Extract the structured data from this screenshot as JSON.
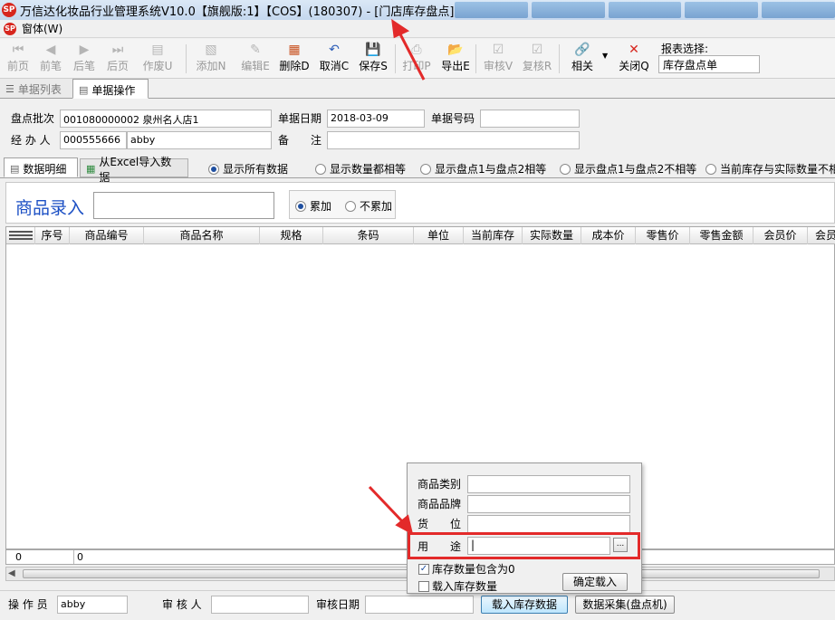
{
  "window": {
    "title": "万信达化妆品行业管理系统V10.0【旗舰版:1】【COS】(180307) - [门店库存盘点]",
    "logo_text": "SP"
  },
  "menu": {
    "items": [
      "窗体(W)"
    ]
  },
  "toolbar": {
    "buttons": [
      {
        "label": "前页",
        "icon": "first-page-icon",
        "enabled": false
      },
      {
        "label": "前笔",
        "icon": "prev-icon",
        "enabled": false
      },
      {
        "label": "后笔",
        "icon": "next-icon",
        "enabled": false
      },
      {
        "label": "后页",
        "icon": "last-page-icon",
        "enabled": false
      },
      {
        "label": "作废U",
        "icon": "void-icon",
        "enabled": false
      },
      {
        "label": "添加N",
        "icon": "add-icon",
        "enabled": false
      },
      {
        "label": "编辑E",
        "icon": "edit-icon",
        "enabled": false
      },
      {
        "label": "删除D",
        "icon": "delete-icon",
        "enabled": true
      },
      {
        "label": "取消C",
        "icon": "undo-icon",
        "enabled": true
      },
      {
        "label": "保存S",
        "icon": "save-icon",
        "enabled": true
      },
      {
        "label": "打印P",
        "icon": "print-icon",
        "enabled": false
      },
      {
        "label": "导出E",
        "icon": "export-icon",
        "enabled": true
      },
      {
        "label": "审核V",
        "icon": "approve-icon",
        "enabled": false
      },
      {
        "label": "复核R",
        "icon": "recheck-icon",
        "enabled": false
      },
      {
        "label": "相关",
        "icon": "link-icon",
        "enabled": true
      },
      {
        "label": "关闭Q",
        "icon": "close-icon",
        "enabled": true
      }
    ],
    "report_label": "报表选择:",
    "report_value": "库存盘点单"
  },
  "tabs": [
    {
      "label": "单据列表",
      "active": false
    },
    {
      "label": "单据操作",
      "active": true
    }
  ],
  "form": {
    "batch_label": "盘点批次",
    "batch_value": "001080000002 泉州名人店1",
    "date_label": "单据日期",
    "date_value": "2018-03-09",
    "docno_label": "单据号码",
    "docno_value": "",
    "handler_label": "经 办 人",
    "handler_code": "000555666",
    "handler_name": "abby",
    "remark_label": "备　　注",
    "remark_value": ""
  },
  "subtabs": [
    {
      "label": "数据明细",
      "active": true
    },
    {
      "label": "从Excel导入数据",
      "active": false
    }
  ],
  "filters": [
    {
      "label": "显示所有数据",
      "selected": true
    },
    {
      "label": "显示数量都相等",
      "selected": false
    },
    {
      "label": "显示盘点1与盘点2相等",
      "selected": false
    },
    {
      "label": "显示盘点1与盘点2不相等",
      "selected": false
    },
    {
      "label": "当前库存与实际数量不相",
      "selected": false
    }
  ],
  "entry": {
    "title": "商品录入",
    "value": "",
    "accumulate": {
      "label": "累加",
      "selected": true
    },
    "no_accumulate": {
      "label": "不累加",
      "selected": false
    }
  },
  "grid": {
    "columns": [
      "序号",
      "商品编号",
      "商品名称",
      "规格",
      "条码",
      "单位",
      "当前库存",
      "实际数量",
      "成本价",
      "零售价",
      "零售金额",
      "会员价",
      "会员"
    ],
    "rows": [],
    "footer_count": "0",
    "footer_value": "0"
  },
  "popup": {
    "category_label": "商品类别",
    "brand_label": "商品品牌",
    "location_label": "货　　位",
    "usage_label": "用　　途",
    "usage_value": "|",
    "usage_button": "...",
    "include_zero_label": "库存数量包含为0",
    "include_zero_checked": true,
    "load_stock_label": "载入库存数量",
    "load_stock_checked": false,
    "confirm_label": "确定载入"
  },
  "bottom": {
    "operator_label": "操 作 员",
    "operator_value": "abby",
    "auditor_label": "审 核 人",
    "auditor_value": "",
    "audit_date_label": "审核日期",
    "audit_date_value": "",
    "load_stock_button": "载入库存数据",
    "collect_button": "数据采集(盘点机)"
  },
  "colors": {
    "accent": "#1b4fc4",
    "highlight": "#e32a2a",
    "logo": "#d7261e"
  }
}
